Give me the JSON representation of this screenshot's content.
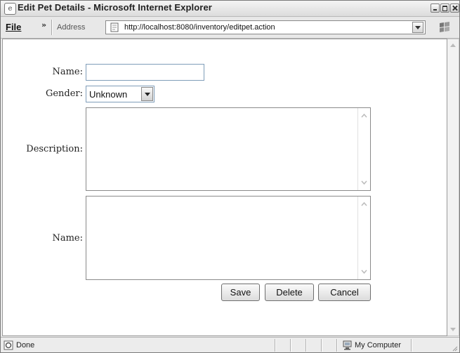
{
  "window": {
    "title": "Edit Pet Details - Microsoft Internet Explorer",
    "icons": [
      "ie-app-icon",
      "minimize-icon",
      "maximize-icon",
      "close-icon"
    ]
  },
  "menubar": {
    "file_label": "File",
    "chevron": "»",
    "address_label": "Address",
    "address_value": "http://localhost:8080/inventory/editpet.action"
  },
  "form": {
    "name_label": "Name:",
    "name_value": "",
    "gender_label": "Gender:",
    "gender_value": "Unknown",
    "description_label": "Description:",
    "description_value": "",
    "name2_label": "Name:",
    "name2_value": "",
    "buttons": {
      "save": "Save",
      "delete": "Delete",
      "cancel": "Cancel"
    }
  },
  "statusbar": {
    "status_text": "Done",
    "zone_text": "My Computer"
  }
}
